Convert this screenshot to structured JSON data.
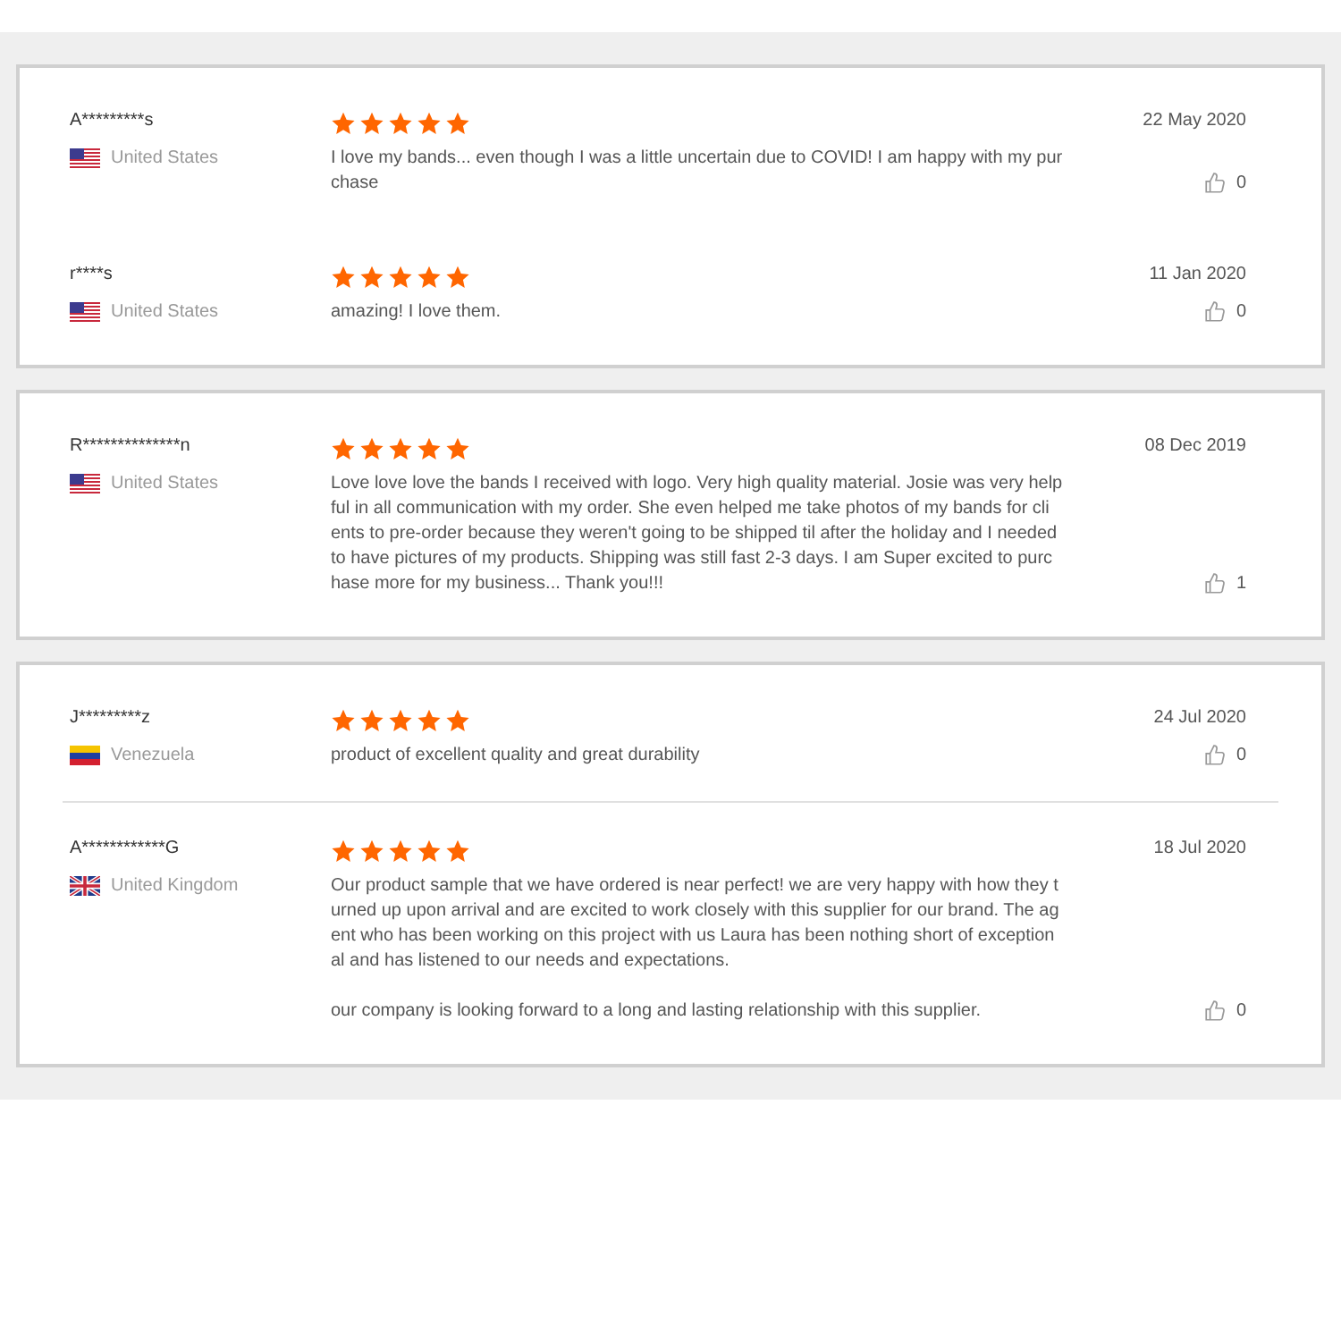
{
  "panels": [
    {
      "reviews": [
        {
          "divided": false,
          "name": "A*********s",
          "country": {
            "kind": "us",
            "name": "United States"
          },
          "stars": 5,
          "date": "22 May 2020",
          "likes": "0",
          "paragraphs": [
            [
              "I love my bands... even though I was a little uncertain due to COVID! I am happy with my pur",
              "chase"
            ]
          ]
        },
        {
          "divided": false,
          "name": "r****s",
          "country": {
            "kind": "us",
            "name": "United States"
          },
          "stars": 5,
          "date": "11 Jan 2020",
          "likes": "0",
          "paragraphs": [
            [
              "amazing! I love them."
            ]
          ]
        }
      ]
    },
    {
      "reviews": [
        {
          "divided": false,
          "name": "R**************n",
          "country": {
            "kind": "us",
            "name": "United States"
          },
          "stars": 5,
          "date": "08 Dec 2019",
          "likes": "1",
          "paragraphs": [
            [
              "Love love love the bands I received with logo. Very high quality material. Josie was very help",
              "ful in all communication with my order. She even helped me take photos of my bands for cli",
              "ents to pre-order because they weren't going to be shipped til after the holiday and I needed",
              "to have pictures of my products. Shipping was still fast 2-3 days. I am Super excited to purc",
              "hase more for my business... Thank you!!!"
            ]
          ]
        }
      ]
    },
    {
      "reviews": [
        {
          "divided": false,
          "name": "J*********z",
          "country": {
            "kind": "ve",
            "name": "Venezuela"
          },
          "stars": 5,
          "date": "24 Jul 2020",
          "likes": "0",
          "paragraphs": [
            [
              "product of excellent quality and great durability"
            ]
          ]
        },
        {
          "divided": true,
          "name": "A************G",
          "country": {
            "kind": "gb",
            "name": "United Kingdom"
          },
          "stars": 5,
          "date": "18 Jul 2020",
          "likes": "0",
          "paragraphs": [
            [
              "Our product sample that we have ordered is near perfect! we are very happy with how they t",
              "urned up upon arrival and are excited to work closely with this supplier for our brand. The ag",
              "ent who has been working on this project with us Laura has been nothing short of exception",
              "al and has listened to our needs and expectations."
            ],
            [
              "our company is looking forward to a long and lasting relationship with this supplier."
            ]
          ]
        }
      ]
    }
  ]
}
